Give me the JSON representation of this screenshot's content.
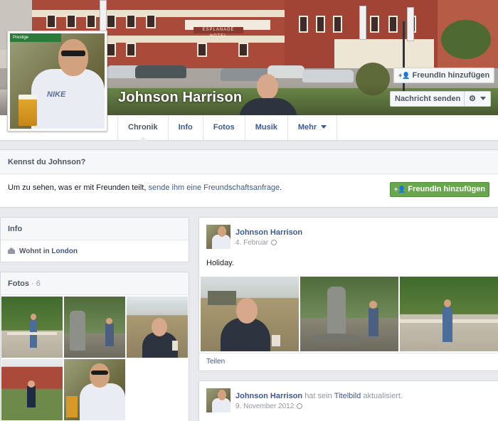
{
  "profile": {
    "name": "Johnson Harrison",
    "cover_sign": "ESPLANADE HOTEL",
    "pic_sign": "Prestige"
  },
  "actions": {
    "add_friend": "FreundIn hinzufügen",
    "send_message": "Nachricht senden",
    "gear_icon": "gear-icon"
  },
  "tabs": [
    {
      "label": "Chronik",
      "active": true
    },
    {
      "label": "Info",
      "active": false
    },
    {
      "label": "Fotos",
      "active": false
    },
    {
      "label": "Musik",
      "active": false
    },
    {
      "label": "Mehr",
      "active": false
    }
  ],
  "know": {
    "title": "Kennst du Johnson?",
    "text_before": "Um zu sehen, was er mit Freunden teilt, ",
    "link": "sende ihm eine Freundschaftsanfrage",
    "text_after": ".",
    "button": "FreundIn hinzufügen"
  },
  "info": {
    "title": "Info",
    "lives_prefix": "Wohnt in",
    "city": "London"
  },
  "photos": {
    "title": "Fotos",
    "separator": " · ",
    "count": "6"
  },
  "posts": [
    {
      "author": "Johnson Harrison",
      "date": "4. Februar",
      "text": "Holiday.",
      "share": "Teilen"
    },
    {
      "author": "Johnson Harrison",
      "action_before": "hat sein",
      "action_link": "Titelbild",
      "action_after": "aktualisiert.",
      "date": "9. November 2012"
    }
  ],
  "colors": {
    "link": "#3b5998",
    "green_button": "#69a74e",
    "page_bg": "#e9eaed"
  }
}
